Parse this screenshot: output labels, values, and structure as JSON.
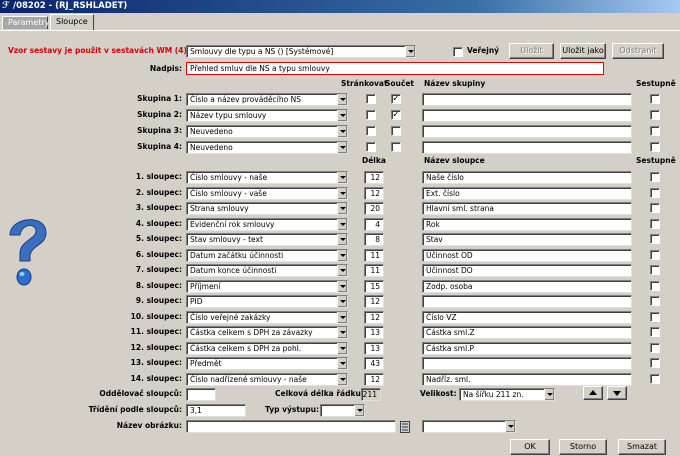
{
  "window": {
    "title": "/08202 - (RJ_RSHLADET)"
  },
  "tabs": {
    "inactive": "Parametry",
    "active": "Sloupce"
  },
  "top": {
    "template_label": "Vzor sestavy je použit v sestavách WM (4).",
    "template_value": "Smlouvy dle typu a NS   ()   [Systémové]",
    "public_label": "Veřejný",
    "public_checked": false,
    "save": "Uložit",
    "save_as": "Uložit jako",
    "remove": "Odstranit",
    "heading_label": "Nadpis:",
    "heading_value": "Přehled smluv dle NS a typu smlouvy"
  },
  "groups": {
    "headers": {
      "pagination": "Stránkovat",
      "sum": "Součet",
      "group_name": "Název skupiny",
      "descending": "Sestupně"
    },
    "rows": [
      {
        "label": "Skupina 1:",
        "value": "Číslo a název prováděcího NS",
        "pagination": false,
        "sum": true,
        "name": "",
        "descending": false
      },
      {
        "label": "Skupina 2:",
        "value": "Název typu smlouvy",
        "pagination": false,
        "sum": true,
        "name": "",
        "descending": false
      },
      {
        "label": "Skupina 3:",
        "value": "Neuvedeno",
        "pagination": false,
        "sum": false,
        "name": "",
        "descending": false
      },
      {
        "label": "Skupina 4:",
        "value": "Neuvedeno",
        "pagination": false,
        "sum": false,
        "name": "",
        "descending": false
      }
    ]
  },
  "columns": {
    "headers": {
      "length": "Délka",
      "column_name": "Název sloupce",
      "descending": "Sestupně"
    },
    "rows": [
      {
        "label": "1. sloupec:",
        "value": "Číslo smlouvy - naše",
        "length": "12",
        "name": "Naše číslo"
      },
      {
        "label": "2. sloupec:",
        "value": "Číslo smlouvy - vaše",
        "length": "12",
        "name": "Ext. číslo"
      },
      {
        "label": "3. sloupec:",
        "value": "Strana smlouvy",
        "length": "20",
        "name": "Hlavní sml. strana"
      },
      {
        "label": "4. sloupec:",
        "value": "Evidenční rok smlouvy",
        "length": "4",
        "name": "Rok"
      },
      {
        "label": "5. sloupec:",
        "value": "Stav smlouvy - text",
        "length": "8",
        "name": "Stav"
      },
      {
        "label": "6. sloupec:",
        "value": "Datum začátku účinnosti",
        "length": "11",
        "name": "Účinnost OD"
      },
      {
        "label": "7. sloupec:",
        "value": "Datum konce účinnosti",
        "length": "11",
        "name": "Účinnost DO"
      },
      {
        "label": "8. sloupec:",
        "value": "Příjmení",
        "length": "15",
        "name": "Zodp. osoba"
      },
      {
        "label": "9. sloupec:",
        "value": "PID",
        "length": "12",
        "name": ""
      },
      {
        "label": "10. sloupec:",
        "value": "Číslo veřejné zakázky",
        "length": "12",
        "name": "Číslo VZ"
      },
      {
        "label": "11. sloupec:",
        "value": "Částka celkem s DPH za závazky",
        "length": "13",
        "name": "Částka sml.Z"
      },
      {
        "label": "12. sloupec:",
        "value": "Částka celkem s DPH za pohl.",
        "length": "13",
        "name": "Částka sml.P"
      },
      {
        "label": "13. sloupec:",
        "value": "Předmět",
        "length": "43",
        "name": ""
      },
      {
        "label": "14. sloupec:",
        "value": "Číslo nadřízené smlouvy - naše",
        "length": "12",
        "name": "Nadříz. sml."
      }
    ]
  },
  "bottom": {
    "separator_label": "Oddělovač sloupců:",
    "separator_value": "",
    "total_width_label": "Celková délka řádku:",
    "total_width_value": "211",
    "size_label": "Velikost:",
    "size_value": "Na šířku 211 zn.",
    "sort_label": "Třídění podle sloupců:",
    "sort_value": "3,1",
    "output_label": "Typ výstupu:",
    "output_value": "",
    "image_label": "Název obrázku:",
    "image_value": "",
    "image_select_value": ""
  },
  "buttons": {
    "ok": "OK",
    "cancel": "Storno",
    "delete": "Smazat"
  },
  "colors": {
    "accent": "#d40000",
    "title_bar": "#0a246a",
    "face": "#d4d0c8"
  }
}
